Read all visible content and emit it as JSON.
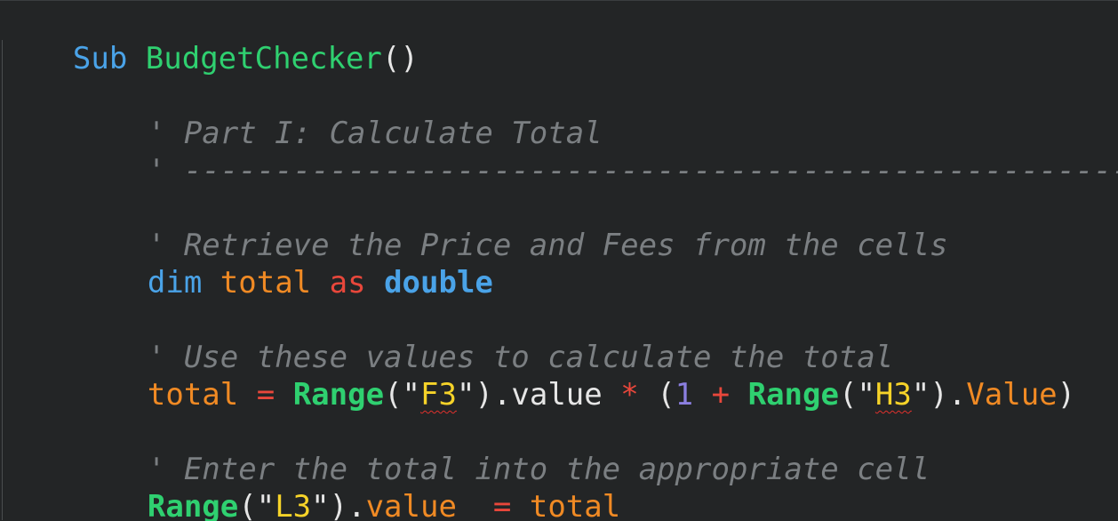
{
  "editor": {
    "lines": {
      "l1": {
        "t1": "Sub",
        "t2": " ",
        "t3": "BudgetChecker",
        "t4": "()"
      },
      "l3": {
        "t1": "' Part I: Calculate Total"
      },
      "l4": {
        "t1": "' ----------------------------------------------------"
      },
      "l6": {
        "t1": "' Retrieve the Price and Fees from the cells"
      },
      "l7": {
        "t1": "dim",
        "t2": " ",
        "t3": "total",
        "t4": " ",
        "t5": "as",
        "t6": " ",
        "t7": "double"
      },
      "l9": {
        "t1": "' Use these values to calculate the total"
      },
      "l10": {
        "t1": "total",
        "t2": " ",
        "t3": "=",
        "t4": " ",
        "t5": "Range",
        "t6": "(\"",
        "t7": "F3",
        "t8": "\").value",
        "t9": " ",
        "t10": "*",
        "t11": " ",
        "t12": "(",
        "t13": "1",
        "t14": " ",
        "t15": "+",
        "t16": " ",
        "t17": "Range",
        "t18": "(\"",
        "t19": "H3",
        "t20": "\").",
        "t21": "Value",
        "t22": ")"
      },
      "l12": {
        "t1": "' Enter the total into the appropriate cell"
      },
      "l13": {
        "t1": "Range",
        "t2": "(\"",
        "t3": "L3",
        "t4": "\").",
        "t5": "value",
        "t6": "  ",
        "t7": "=",
        "t8": " ",
        "t9": "total"
      }
    },
    "colors": {
      "background": "#232526",
      "comment": "#7b7f82",
      "keyword": "#4aa3e8",
      "function": "#2fd070",
      "variable": "#f08a24",
      "operator": "#e8473b",
      "string": "#f6d329",
      "number": "#8b7fe0",
      "spell_error": "#e0312d"
    }
  }
}
